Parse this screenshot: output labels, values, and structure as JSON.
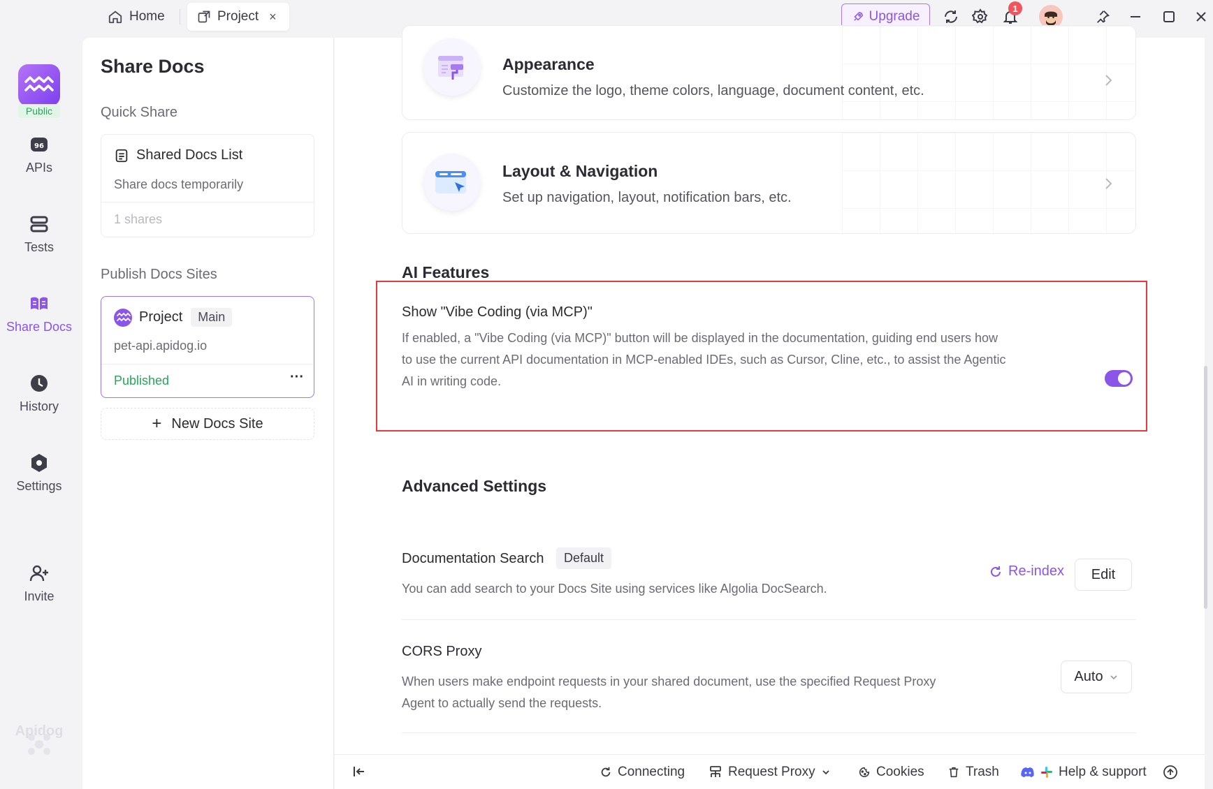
{
  "tabs": {
    "home": "Home",
    "project": "Project",
    "close": "×"
  },
  "topbar": {
    "upgrade": "Upgrade",
    "notification_count": "1"
  },
  "rail": {
    "public": "Public",
    "items": [
      {
        "label": "APIs"
      },
      {
        "label": "Tests"
      },
      {
        "label": "Share Docs"
      },
      {
        "label": "History"
      },
      {
        "label": "Settings"
      },
      {
        "label": "Invite"
      }
    ],
    "brand": "Apidog"
  },
  "panel": {
    "title": "Share Docs",
    "quick_share": "Quick Share",
    "shared_list": {
      "title": "Shared Docs List",
      "desc": "Share docs temporarily",
      "count": "1 shares"
    },
    "publish_title": "Publish Docs Sites",
    "site": {
      "name": "Project",
      "branch": "Main",
      "domain": "pet-api.apidog.io",
      "status": "Published",
      "more": "···"
    },
    "new_site": "New Docs Site",
    "new_site_plus": "+"
  },
  "main": {
    "appearance": {
      "title": "Appearance",
      "desc": "Customize the logo, theme colors, language, document content, etc."
    },
    "layout": {
      "title": "Layout & Navigation",
      "desc": "Set up navigation, layout, notification bars, etc."
    },
    "ai": {
      "title": "AI Features",
      "option_title": "Show \"Vibe Coding (via MCP)\"",
      "option_desc_1": "If enabled, a \"Vibe Coding (via MCP)\" button will be displayed in the documentation, guiding end users how",
      "option_desc_2": "to use the current API documentation in MCP-enabled IDEs, such as Cursor, Cline, etc., to assist the Agentic",
      "option_desc_3": "AI in writing code.",
      "enabled": true
    },
    "advanced": {
      "title": "Advanced Settings",
      "search_title": "Documentation Search",
      "search_badge": "Default",
      "search_desc": "You can add search to your Docs Site using services like Algolia DocSearch.",
      "reindex": "Re-index",
      "edit": "Edit",
      "cors_title": "CORS Proxy",
      "cors_desc_1": "When users make endpoint requests in your shared document, use the specified Request Proxy",
      "cors_desc_2": "Agent to actually send the requests.",
      "cors_value": "Auto"
    }
  },
  "footer": {
    "connecting": "Connecting",
    "request_proxy": "Request Proxy",
    "cookies": "Cookies",
    "trash": "Trash",
    "help": "Help & support"
  },
  "colors": {
    "accent": "#8a55e9",
    "highlight": "#e83a3a",
    "published": "#26a65b"
  }
}
